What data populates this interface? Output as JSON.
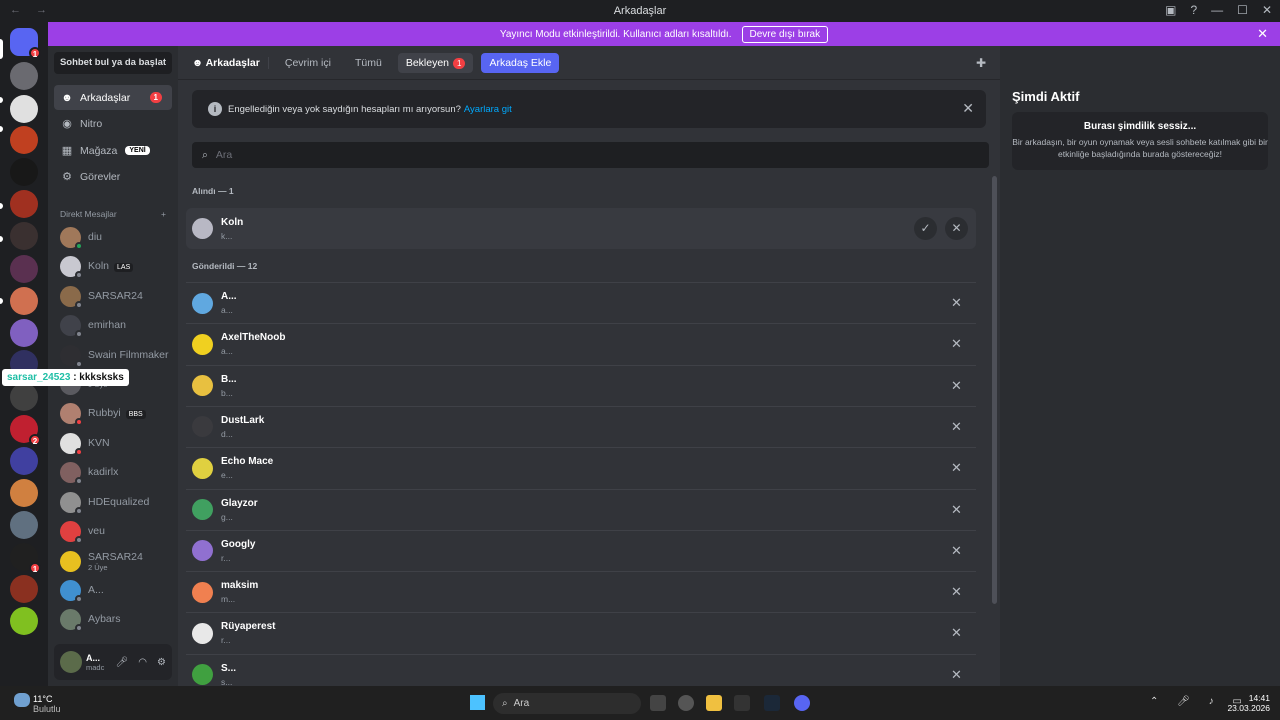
{
  "window": {
    "title": "Arkadaşlar"
  },
  "banner": {
    "text": "Yayıncı Modu etkinleştirildi. Kullanıcı adları kısaltıldı.",
    "button": "Devre dışı bırak"
  },
  "sidebar": {
    "search": "Sohbet bul ya da başlat",
    "nav": [
      {
        "label": "Arkadaşlar",
        "badge": "1"
      },
      {
        "label": "Nitro"
      },
      {
        "label": "Mağaza",
        "tag": "YENİ"
      },
      {
        "label": "Görevler"
      }
    ],
    "dm_header": "Direkt Mesajlar",
    "dms": [
      {
        "name": "diu",
        "color": "#a0785a",
        "status": "#23a55a"
      },
      {
        "name": "Koln",
        "tag": "LAS",
        "color": "#c8c8d0",
        "status": "#80848e"
      },
      {
        "name": "SARSAR24",
        "color": "#8a6a4a",
        "status": "#80848e"
      },
      {
        "name": "emirhan",
        "color": "#40424a",
        "status": "#80848e"
      },
      {
        "name": "Swain Filmmaker",
        "color": "#2e2e32",
        "status": "#80848e"
      },
      {
        "name": "",
        "sub": "9 Üye",
        "color": "#5a5a60",
        "status": ""
      },
      {
        "name": "Rubbyi",
        "tag": "BBS",
        "color": "#b08070",
        "status": "#f23f43"
      },
      {
        "name": "KVN",
        "color": "#e0e0e0",
        "status": "#f23f43"
      },
      {
        "name": "kadirlx",
        "color": "#806060",
        "status": "#80848e"
      },
      {
        "name": "HDEqualized",
        "color": "#909090",
        "status": "#80848e"
      },
      {
        "name": "veu",
        "color": "#e04040",
        "status": "#80848e"
      },
      {
        "name": "SARSAR24",
        "sub": "2 Üye",
        "color": "#e8c020",
        "status": ""
      },
      {
        "name": "A...",
        "color": "#4090d0",
        "status": "#80848e"
      },
      {
        "name": "Aybars",
        "color": "#6a7a6a",
        "status": "#80848e"
      }
    ],
    "user": {
      "name": "A...",
      "status": "madc"
    },
    "tip": {
      "user": "sarsar_24523",
      "msg": ": kkksksks"
    }
  },
  "topbar": {
    "title": "Arkadaşlar",
    "tabs": [
      "Çevrim içi",
      "Tümü",
      "Bekleyen"
    ],
    "pending_badge": "1",
    "add": "Arkadaş Ekle"
  },
  "notice": {
    "text": "Engellediğin veya yok saydığın hesapları mı arıyorsun?",
    "link": "Ayarlara git"
  },
  "search_placeholder": "Ara",
  "received": {
    "header": "Alındı — 1",
    "items": [
      {
        "name": "Koln",
        "sub": "k...",
        "color": "#b8b8c4"
      }
    ]
  },
  "sent": {
    "header": "Gönderildi — 12",
    "items": [
      {
        "name": "A...",
        "sub": "a...",
        "color": "#60a8e0"
      },
      {
        "name": "AxelTheNoob",
        "sub": "a...",
        "color": "#f0d020"
      },
      {
        "name": "B...",
        "sub": "b...",
        "color": "#e8c040"
      },
      {
        "name": "DustLark",
        "sub": "d...",
        "color": "#3a3a3e"
      },
      {
        "name": "Echo Mace",
        "sub": "e...",
        "color": "#e0d040"
      },
      {
        "name": "Glayzor",
        "sub": "g...",
        "color": "#40a060"
      },
      {
        "name": "Googly",
        "sub": "r...",
        "color": "#9070d0"
      },
      {
        "name": "maksim",
        "sub": "m...",
        "color": "#f08050"
      },
      {
        "name": "Rüyaperest",
        "sub": "r...",
        "color": "#e8e8e8"
      },
      {
        "name": "S...",
        "sub": "s...",
        "color": "#40a040"
      }
    ]
  },
  "active": {
    "title": "Şimdi Aktif",
    "empty_title": "Burası şimdilik sessiz...",
    "empty_desc": "Bir arkadaşın, bir oyun oynamak veya sesli sohbete katılmak gibi bir etkinliğe başladığında burada göstereceğiz!"
  },
  "taskbar": {
    "weather_temp": "11°C",
    "weather_desc": "Bulutlu",
    "search": "Ara",
    "time": "14:41",
    "date": "23.03.2026"
  }
}
